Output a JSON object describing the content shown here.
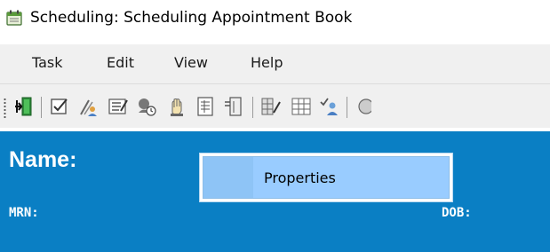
{
  "window": {
    "title": "Scheduling: Scheduling Appointment Book",
    "icon": "calendar-app-icon"
  },
  "menubar": {
    "items": [
      {
        "label": "Task"
      },
      {
        "label": "Edit"
      },
      {
        "label": "View"
      },
      {
        "label": "Help"
      }
    ]
  },
  "toolbar": {
    "icons": [
      "exit-door-icon",
      "checkbox-icon",
      "person-pen-icon",
      "form-edit-icon",
      "clock-appointment-icon",
      "hand-stop-icon",
      "document-grid-icon",
      "door-edit-icon",
      "grid-sign-icon",
      "grid-schedule-icon",
      "check-person-icon",
      "partial-icon"
    ]
  },
  "banner": {
    "name_label": "Name:",
    "mrn_label": "MRN:",
    "dob_label": "DOB:",
    "background_color": "#0a7fc4"
  },
  "context_menu": {
    "items": [
      {
        "label": "Properties"
      }
    ],
    "highlight_color": "#99ccff"
  }
}
